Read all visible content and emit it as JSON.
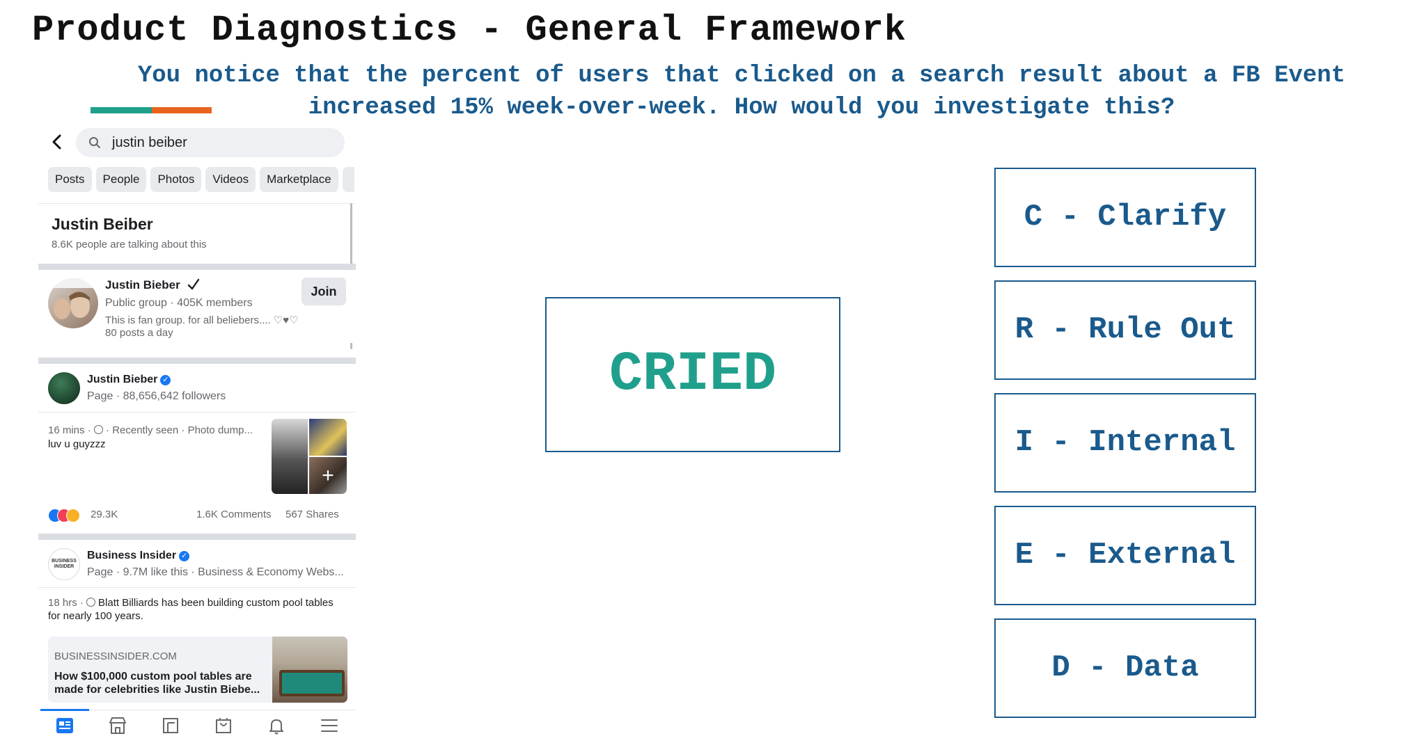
{
  "slide": {
    "title": "Product Diagnostics - General Framework",
    "question_line1": "You notice that the percent of users that clicked on a search result about a FB Event",
    "question_line2": "increased 15% week-over-week. How would you investigate this?"
  },
  "colors": {
    "teal": "#20a08c",
    "orange": "#e8641e",
    "blue": "#1a5a8c",
    "fb_blue": "#1877f2"
  },
  "search": {
    "query": "justin beiber"
  },
  "filter_chips": [
    "Posts",
    "People",
    "Photos",
    "Videos",
    "Marketplace"
  ],
  "topic": {
    "title": "Justin Beiber",
    "subtitle": "8.6K people are talking about this"
  },
  "group": {
    "name": "Justin Bieber",
    "meta": "Public group · 405K members",
    "description": "This is fan group.  for all beliebers.... ♡♥♡",
    "activity": "80 posts a day",
    "join_label": "Join",
    "badge_icon": "checkmark-icon"
  },
  "page": {
    "name": "Justin Bieber",
    "meta": "Page · 88,656,642 followers"
  },
  "post": {
    "meta": "16 mins · ",
    "meta_tail": " · Recently seen · Photo dump...",
    "text": "luv u guyzzz",
    "photo_more": "+",
    "reactions": "29.3K",
    "comments": "1.6K Comments",
    "shares": "567 Shares"
  },
  "publisher": {
    "name": "Business Insider",
    "logo_text": "BUSINESS INSIDER",
    "meta": "Page · 9.7M like this · Business & Economy Webs..."
  },
  "article": {
    "meta": "18 hrs · ",
    "text": "Blatt Billiards has been building custom pool tables for nearly 100 years.",
    "domain": "BUSINESSINSIDER.COM",
    "headline": "How $100,000 custom pool tables are made for celebrities like Justin Biebe..."
  },
  "bottom_nav": [
    "news-feed-icon",
    "marketplace-icon",
    "pages-icon",
    "shop-icon",
    "notifications-icon",
    "menu-icon"
  ],
  "framework": {
    "acronym": "CRIED",
    "steps": [
      "C - Clarify",
      "R - Rule Out",
      "I - Internal",
      "E - External",
      "D - Data"
    ]
  }
}
